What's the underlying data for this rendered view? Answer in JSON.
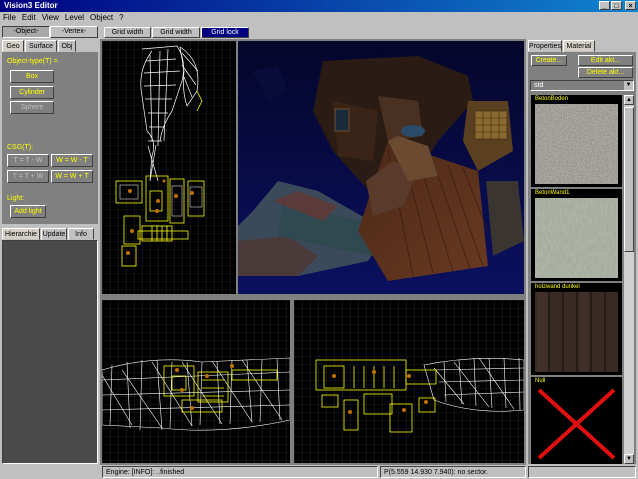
{
  "window": {
    "title": "Vision3 Editor",
    "min": "_",
    "max": "□",
    "close": "×"
  },
  "menu": [
    "File",
    "Edit",
    "View",
    "Level",
    "Object",
    "?"
  ],
  "mode_tabs": {
    "object": "-Object-",
    "vertex": "-Vertex-"
  },
  "geo_tabs": [
    "Geo",
    "Surface",
    "Obj"
  ],
  "object_type_label": "Object-type(T) =",
  "object_buttons": [
    "Box",
    "Cylinder",
    "Sphere"
  ],
  "csg_label": "CSG(T):",
  "csg_buttons": [
    "T = T - W",
    "W = W - T",
    "T = T + W",
    "W = W + T"
  ],
  "light_label": "Light:",
  "add_light": "Add light",
  "hier_tabs": [
    "Hierarchie",
    "Update",
    "Info"
  ],
  "grid_buttons": [
    "Grid width 0.5X",
    "Grid width 2.0X",
    "Grid lock"
  ],
  "right_tabs": [
    "Properties",
    "Material"
  ],
  "material_buttons": {
    "create": "Create...",
    "edit": "Edit akt...",
    "delete": "Delete akt..."
  },
  "material_select": "std",
  "textures": [
    {
      "name": "BetonBoden"
    },
    {
      "name": "BetonWand1"
    },
    {
      "name": "holzwand dunkel"
    },
    {
      "name": "Null"
    }
  ],
  "status": {
    "engine": "Engine: [INFO]: ..finished",
    "position": "P(5.559 14.930 7.940): no sector."
  }
}
